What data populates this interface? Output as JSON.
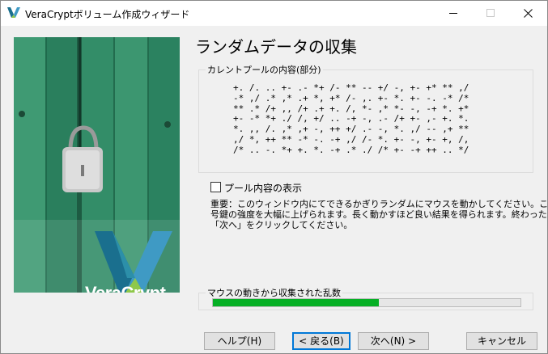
{
  "window": {
    "title": "VeraCryptボリューム作成ウィザード"
  },
  "page": {
    "title": "ランダムデータの収集"
  },
  "brand": {
    "name": "VeraCrypt"
  },
  "pool": {
    "legend": "カレントプールの内容(部分)",
    "lines": [
      "+. /. .. +- .- *+ /- ** -- +/ -, +- +* ** ,/",
      "-* ,/ .* ,* .+ *, +* /- ,. +- *. +- -. -* /*",
      "** .* /+ ,, /+ .+ +. /, *- ,* *- -, -+ *. +*",
      "+- -* *+ ./ /, +/ .. -+ -, .- /+ +- ,- +. *.",
      "*. ,, /. ,* ,+ -, ++ +/ .- -, *. ,/ -- ,+ **",
      ",/ *, ++ ** -* -. -+ ,/ /- *. +- -, +- +, /,",
      "/* .. -. *+ +. *. -+ .* ./ /* +- -+ ++ .. */"
    ]
  },
  "checkbox": {
    "label": "プール内容の表示",
    "checked": false
  },
  "info": {
    "lines": [
      "重要：このウィンドウ内にてできるかぎりランダムにマウスを動かしてください。これにより暗",
      "号鍵の強度を大幅に上げられます。長く動かすほど良い結果を得られます。終わったら",
      "「次へ」をクリックしてください。"
    ]
  },
  "progress": {
    "legend": "マウスの動きから収集された乱数",
    "value": 0.54,
    "color": "#06b025"
  },
  "buttons": {
    "help": "ヘルプ(H)",
    "back": "< 戻る(B)",
    "next": "次へ(N) >",
    "cancel": "キャンセル"
  },
  "colors": {
    "accent": "#0078d7",
    "logo_dark": "#1a6f8e",
    "logo_light": "#8ec84a",
    "door": "#2f8a66"
  }
}
